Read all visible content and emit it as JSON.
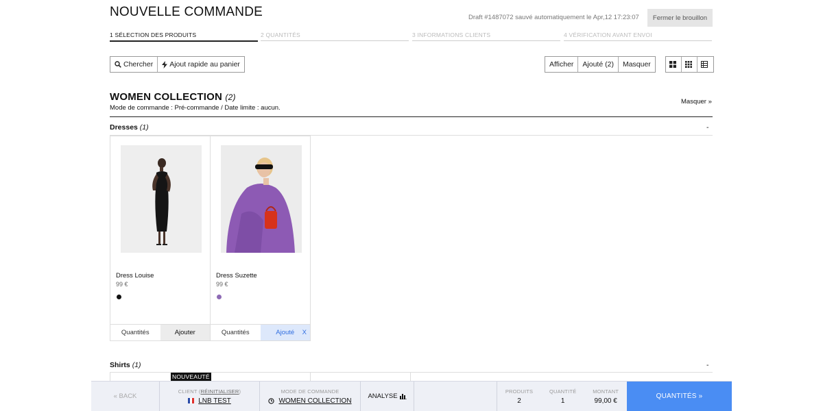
{
  "header": {
    "title": "NOUVELLE COMMANDE",
    "draft_info": "Draft #1487072 sauvé automatiquement le Apr,12 17:23:07",
    "close_draft_label": "Fermer le brouillon"
  },
  "steps": [
    {
      "label": "1 SÉLECTION DES PRODUITS",
      "active": true
    },
    {
      "label": "2 QUANTITÉS",
      "active": false
    },
    {
      "label": "3 INFORMATIONS CLIENTS",
      "active": false
    },
    {
      "label": "4 VÉRIFICATION AVANT ENVOI",
      "active": false
    }
  ],
  "toolbar": {
    "search_label": "Chercher",
    "quick_add_label": "Ajout rapide au panier",
    "filter_show": "Afficher",
    "filter_added": "Ajouté (2)",
    "filter_hide": "Masquer",
    "view_icons": [
      "grid-large-icon",
      "grid-small-icon",
      "list-icon"
    ]
  },
  "collection": {
    "title": "WOMEN COLLECTION",
    "count": "(2)",
    "mode_text": "Mode de commande : Pré-commande / Date limite : aucun.",
    "hide_label": "Masquer »"
  },
  "categories": [
    {
      "name": "Dresses",
      "count": "(1)",
      "toggle": "-"
    },
    {
      "name": "Shirts",
      "count": "(1)",
      "toggle": "-"
    }
  ],
  "products": [
    {
      "name": "Dress Louise",
      "price": "99 €",
      "swatch_color": "#111111",
      "qty_label": "Quantités",
      "action_label": "Ajouter",
      "added": false
    },
    {
      "name": "Dress Suzette",
      "price": "99 €",
      "swatch_color": "#8e6bb5",
      "qty_label": "Quantités",
      "action_label": "Ajouté",
      "remove_label": "X",
      "added": true
    }
  ],
  "new_badge": "NOUVEAUTÉ",
  "bottom_bar": {
    "back_label": "« BACK",
    "client_label": "CLIENT",
    "client_reset": "RÉINITIALISER",
    "client_name": "LNB TEST",
    "mode_label": "MODE DE COMMANDE",
    "mode_value": "WOMEN COLLECTION",
    "analyse_label": "ANALYSE",
    "products_label": "PRODUITS",
    "products_value": "2",
    "quantity_label": "QUANTITÉ",
    "quantity_value": "1",
    "amount_label": "MONTANT",
    "amount_value": "99,00 €",
    "next_label": "QUANTITÉS »"
  },
  "colors": {
    "accent": "#4a8df3",
    "added_bg": "#dde8fb",
    "added_text": "#2f6de0"
  }
}
